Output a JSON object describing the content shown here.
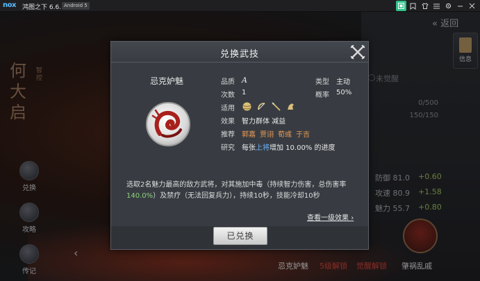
{
  "titlebar": {
    "logo": "nox",
    "title": "鸿图之下 6.6.1.2",
    "android": "Android 5"
  },
  "scene": {
    "calligraphy": "何大启",
    "side_tag": "智控",
    "back_label": "返回",
    "info_label": "信息",
    "awake_label": "未觉醒",
    "bar1": "0/500",
    "bar2": "150/150",
    "menu": [
      "兑换",
      "攻略",
      "传记"
    ],
    "stats": [
      {
        "label": "防御 81.0",
        "delta": "+0.60"
      },
      {
        "label": "攻速 80.9",
        "delta": "+1.58"
      },
      {
        "label": "魅力 55.7",
        "delta": "+0.80"
      }
    ],
    "bottom_labels": [
      "忌克妒魅",
      "5级解锁",
      "觉醒解锁",
      "肇祸乱戚"
    ],
    "colors": {
      "locked": "#d0453a",
      "accent_green": "#9bc35e"
    }
  },
  "dialog": {
    "title": "兑换武技",
    "skill_name": "忌克妒魅",
    "quality_label": "品质",
    "quality_value": "A",
    "type_label": "类型",
    "type_value": "主动",
    "times_label": "次数",
    "times_value": "1",
    "prob_label": "概率",
    "prob_value": "50%",
    "applicable_label": "适用",
    "weapon_icons": [
      "ball-icon",
      "bow-icon",
      "spear-icon",
      "horse-icon"
    ],
    "effect_label": "效果",
    "effect_value": "智力群体 减益",
    "recommend_label": "推荐",
    "recommend_values": [
      "郭嘉",
      "贾诩",
      "荀彧",
      "于吉"
    ],
    "research_label": "研究",
    "research_prefix": "每张",
    "research_highlight": "上将",
    "research_suffix": "增加 10.00% 的进度",
    "desc_part1": "选取2名魅力最高的敌方武将，对其施加中毒（持续智力伤害，总伤害率",
    "desc_highlight": "140.0%",
    "desc_part2": "）及禁疗（无法回复兵力），持续10秒，技能冷却10秒",
    "more_link": "查看一级效果",
    "redeem_button": "已兑换"
  }
}
